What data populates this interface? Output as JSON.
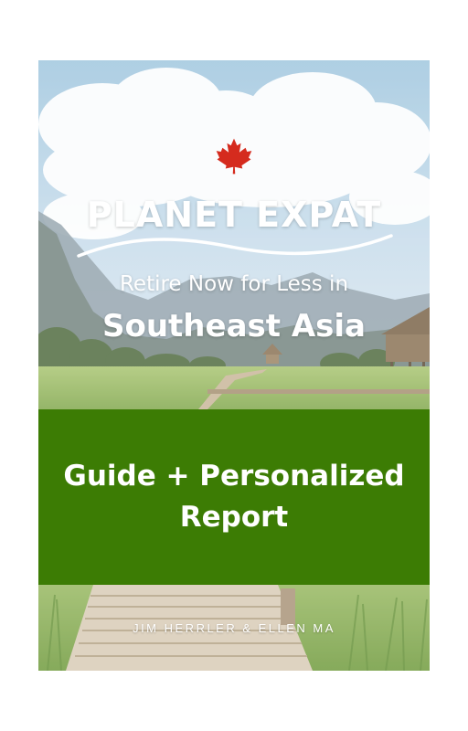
{
  "cover": {
    "brand": "PLANET EXPAT",
    "tagline": "Retire Now for Less in",
    "region": "Southeast Asia",
    "product": "Guide + Personalized Report",
    "authors": "JIM HERRLER & ELLEN MA"
  },
  "icons": {
    "emblem": "maple-leaf-icon"
  },
  "colors": {
    "band_green": "#3c7c04",
    "maple_red": "#d52b1e",
    "text_white": "#ffffff"
  }
}
